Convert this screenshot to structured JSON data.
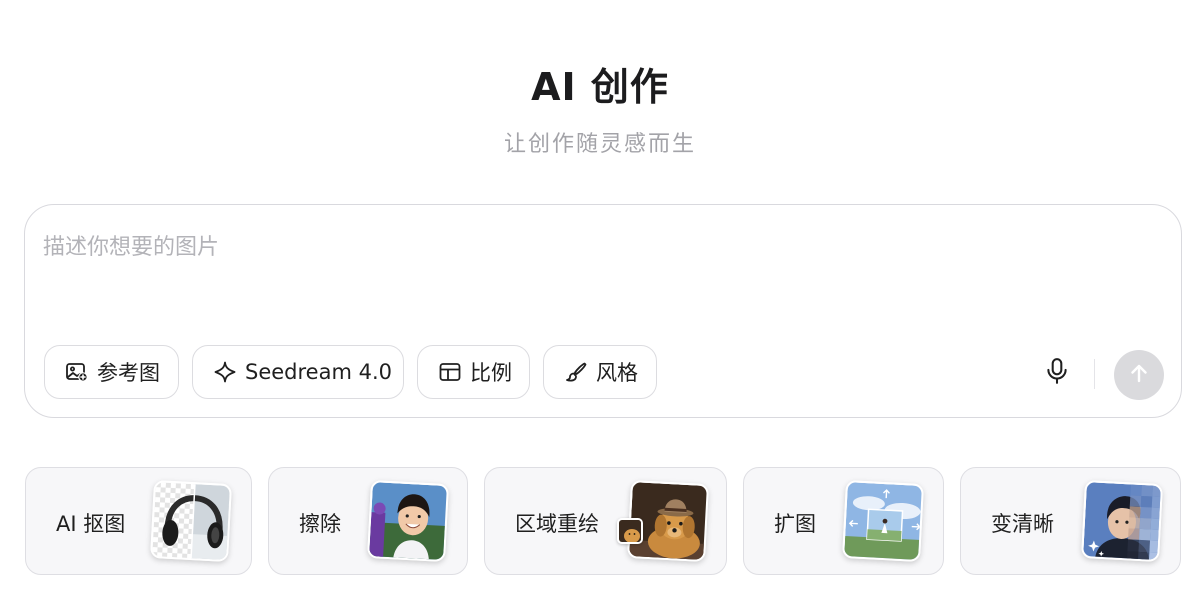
{
  "header": {
    "title": "AI 创作",
    "subtitle": "让创作随灵感而生"
  },
  "prompt": {
    "placeholder": "描述你想要的图片",
    "value": ""
  },
  "chips": {
    "reference": "参考图",
    "model": "Seedream 4.0",
    "ratio": "比例",
    "style": "风格"
  },
  "tools": [
    {
      "label": "AI 抠图",
      "thumbnail": "headphones-cutout"
    },
    {
      "label": "擦除",
      "thumbnail": "girl-smiling"
    },
    {
      "label": "区域重绘",
      "thumbnail": "dog-with-hat"
    },
    {
      "label": "扩图",
      "thumbnail": "expand-landscape"
    },
    {
      "label": "变清晰",
      "thumbnail": "portrait-sharpen"
    }
  ],
  "colors": {
    "send_button": "#dadadd",
    "border": "#d9d9de",
    "placeholder": "#b3b3b8",
    "subtitle": "#a3a3a8"
  },
  "icons": {
    "reference": "image-add-icon",
    "model": "sparkle-icon",
    "ratio": "aspect-ratio-icon",
    "style": "brush-icon",
    "voice": "microphone-icon",
    "send": "arrow-up-icon"
  }
}
